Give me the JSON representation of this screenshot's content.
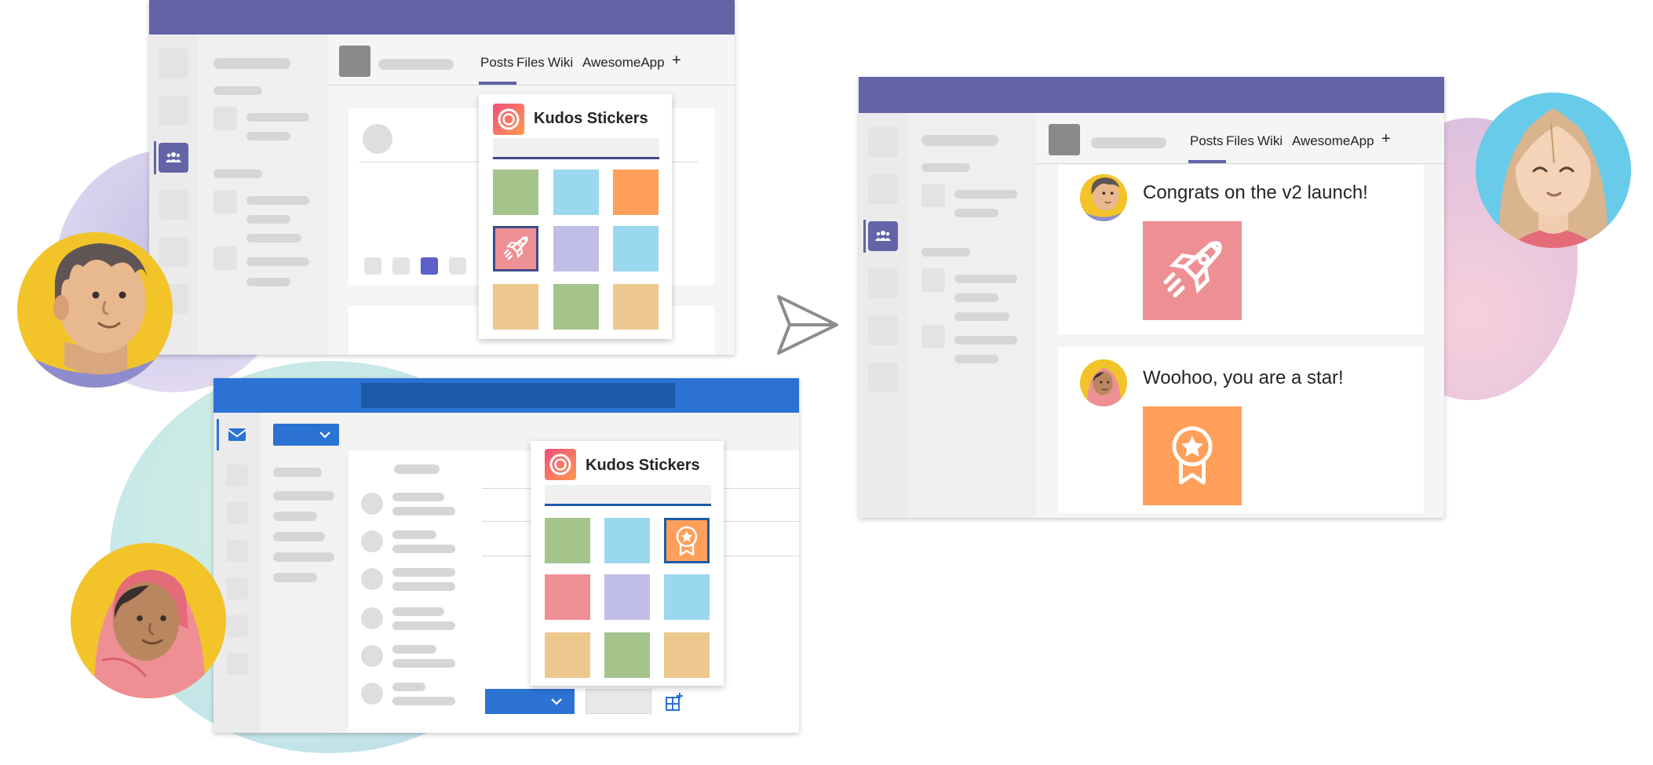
{
  "colors": {
    "teams_purple": "#6264a7",
    "outlook_blue": "#2b72d3",
    "outlook_title": "#1d5aa8",
    "sticker_green": "#a4c48c",
    "sticker_sky": "#9ad8f0",
    "sticker_orange": "#ff9f5a",
    "sticker_pink": "#ee8f94",
    "sticker_lavender": "#c0bde6",
    "sticker_sand": "#edc88e"
  },
  "teams_top": {
    "tabs": [
      "Posts",
      "Files",
      "Wiki",
      "AwesomeApp"
    ],
    "add_tab": "+",
    "teams_icon": "teams-icon"
  },
  "sticker_panel_teams": {
    "title": "Kudos Stickers",
    "logo": "kudos-logo-icon",
    "selected_sticker": "rocket-icon"
  },
  "outlook": {
    "mail_icon": "mail-icon",
    "dropdown_icon": "chevron-down-icon",
    "addin_icon": "add-in-grid-icon"
  },
  "sticker_panel_outlook": {
    "title": "Kudos Stickers",
    "logo": "kudos-logo-icon",
    "selected_sticker": "award-icon"
  },
  "send_icon": "send-icon",
  "teams_right": {
    "tabs": [
      "Posts",
      "Files",
      "Wiki",
      "AwesomeApp"
    ],
    "add_tab": "+",
    "messages": [
      {
        "text": "Congrats on the v2 launch!",
        "sticker": "rocket-icon",
        "sticker_color": "#ee8f94"
      },
      {
        "text": "Woohoo, you are a star!",
        "sticker": "award-icon",
        "sticker_color": "#ff9f5a"
      }
    ]
  }
}
